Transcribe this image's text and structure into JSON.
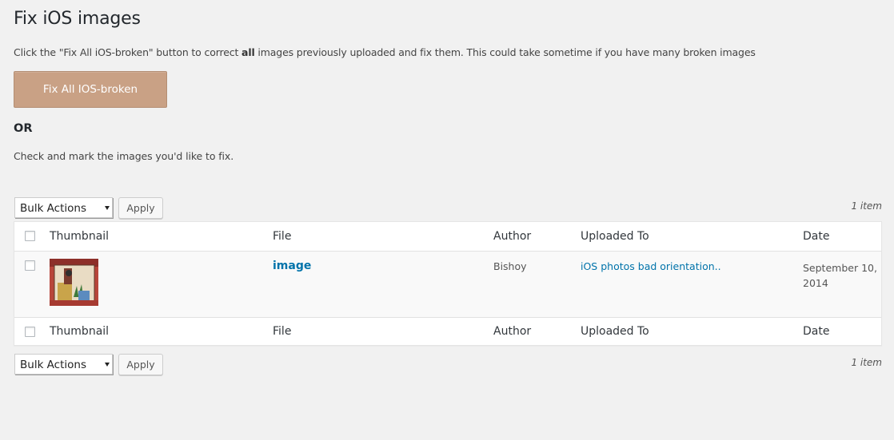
{
  "page": {
    "title": "Fix iOS images",
    "intro_before": "Click the \"Fix All iOS-broken\" button to correct ",
    "intro_bold": "all",
    "intro_after": " images previously uploaded and fix them. This could take sometime if you have many broken images",
    "fix_button_label": "Fix All IOS-broken",
    "or_label": "OR",
    "check_note": "Check and mark the images you'd like to fix."
  },
  "tablenav": {
    "bulk_actions_label": "Bulk Actions",
    "apply_label": "Apply",
    "item_count": "1 item"
  },
  "table": {
    "columns": {
      "thumbnail": "Thumbnail",
      "file": "File",
      "author": "Author",
      "uploaded_to": "Uploaded To",
      "date": "Date"
    },
    "rows": [
      {
        "file": "image",
        "author": "Bishoy",
        "uploaded_to": "iOS photos bad orientation..",
        "date": "September 10, 2014"
      }
    ]
  },
  "colors": {
    "primary_button": "#c9a185",
    "link": "#0073aa",
    "background": "#f1f1f1"
  },
  "icons": {
    "select_arrow": "chevron-down-icon"
  }
}
